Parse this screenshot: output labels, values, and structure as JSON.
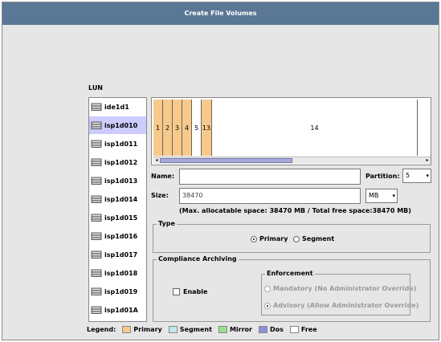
{
  "window": {
    "title": "Create File Volumes"
  },
  "lun": {
    "label": "LUN",
    "items": [
      {
        "name": "ide1d1",
        "selected": false
      },
      {
        "name": "isp1d010",
        "selected": true
      },
      {
        "name": "isp1d011",
        "selected": false
      },
      {
        "name": "isp1d012",
        "selected": false
      },
      {
        "name": "isp1d013",
        "selected": false
      },
      {
        "name": "isp1d014",
        "selected": false
      },
      {
        "name": "isp1d015",
        "selected": false
      },
      {
        "name": "isp1d016",
        "selected": false
      },
      {
        "name": "isp1d017",
        "selected": false
      },
      {
        "name": "isp1d018",
        "selected": false
      },
      {
        "name": "isp1d019",
        "selected": false
      },
      {
        "name": "isp1d01A",
        "selected": false
      }
    ]
  },
  "partitions": [
    {
      "label": "1",
      "type": "primary"
    },
    {
      "label": "2",
      "type": "primary"
    },
    {
      "label": "3",
      "type": "primary"
    },
    {
      "label": "4",
      "type": "primary"
    },
    {
      "label": "5",
      "type": "free"
    },
    {
      "label": "13",
      "type": "primary"
    },
    {
      "label": "14",
      "type": "free"
    }
  ],
  "form": {
    "name_label": "Name:",
    "name_value": "",
    "partition_label": "Partition:",
    "partition_value": "5",
    "size_label": "Size:",
    "size_value": "38470",
    "unit_value": "MB",
    "note": "(Max. allocatable space: 38470 MB / Total free space:38470 MB)"
  },
  "type_group": {
    "title": "Type",
    "primary_label": "Primary",
    "segment_label": "Segment",
    "selected": "Primary"
  },
  "compliance": {
    "title": "Compliance Archiving",
    "enable_label": "Enable",
    "enforcement_title": "Enforcement",
    "mandatory_label": "Mandatory (No Administrator Override)",
    "advisory_label": "Advisory (Allow Administrator Override)"
  },
  "legend": {
    "label": "Legend:",
    "items": [
      {
        "label": "Primary",
        "color": "#f7c98b"
      },
      {
        "label": "Segment",
        "color": "#bfe7ee"
      },
      {
        "label": "Mirror",
        "color": "#99e08a"
      },
      {
        "label": "Dos",
        "color": "#8f8fe0"
      },
      {
        "label": "Free",
        "color": "#ffffff"
      }
    ]
  }
}
